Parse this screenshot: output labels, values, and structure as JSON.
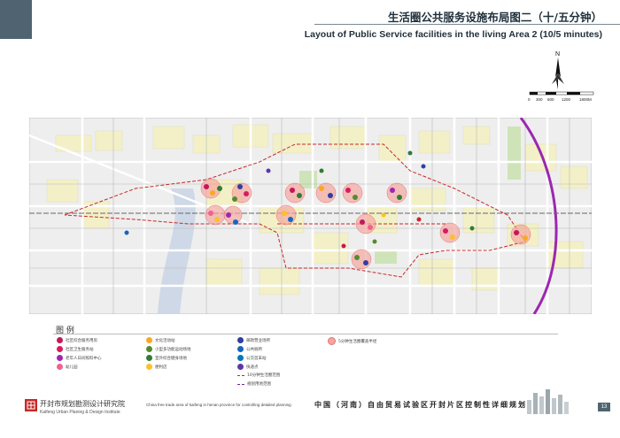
{
  "header": {
    "title_cn": "生活圈公共服务设施布局图二（十/五分钟）",
    "title_en": "Layout of Public Service facilities in the living Area 2 (10/5 minutes)"
  },
  "compass": {
    "label": "N"
  },
  "scale": {
    "ticks": [
      "0",
      "300",
      "600",
      "1200",
      "1800M"
    ]
  },
  "legend": {
    "title": "图 例",
    "items": [
      {
        "label": "社区综合服务用房",
        "color": "#c2185b",
        "shape": "dot"
      },
      {
        "label": "社区卫生服务站",
        "color": "#d81b60",
        "shape": "dot"
      },
      {
        "label": "老年人日间照料中心",
        "color": "#9c27b0",
        "shape": "dot"
      },
      {
        "label": "幼儿园",
        "color": "#f06292",
        "shape": "dot"
      },
      {
        "label": "文化活动站",
        "color": "#f9a825",
        "shape": "dot"
      },
      {
        "label": "小型多功能运动场地",
        "color": "#558b2f",
        "shape": "dot"
      },
      {
        "label": "室外综合健身场地",
        "color": "#2e7d32",
        "shape": "dot"
      },
      {
        "label": "便利店",
        "color": "#fbc02d",
        "shape": "dot"
      },
      {
        "label": "邮政营业场所",
        "color": "#303f9f",
        "shape": "dot"
      },
      {
        "label": "公共厕所",
        "color": "#1565c0",
        "shape": "dot"
      },
      {
        "label": "公交首末站",
        "color": "#0277bd",
        "shape": "dot"
      },
      {
        "label": "快递点",
        "color": "#5e35b1",
        "shape": "dot"
      },
      {
        "label": "5分钟生活圈覆盖半径",
        "color": "#e57373",
        "shape": "circle"
      },
      {
        "label": "10分钟生活圈范围",
        "color": "#c62828",
        "shape": "dash"
      },
      {
        "label": "规划用地范围",
        "color": "#7b1fa2",
        "shape": "dash"
      }
    ]
  },
  "footer": {
    "institute_cn": "开封市规划勘测设计研究院",
    "institute_en": "Kaifeng Urban Planing & Design Institute",
    "project_en": "China free trade area of kaifeng in henan province for controlling detailed planning",
    "project_cn": "中国（河南）自由贸易试验区开封片区控制性详细规划",
    "page": "13"
  }
}
